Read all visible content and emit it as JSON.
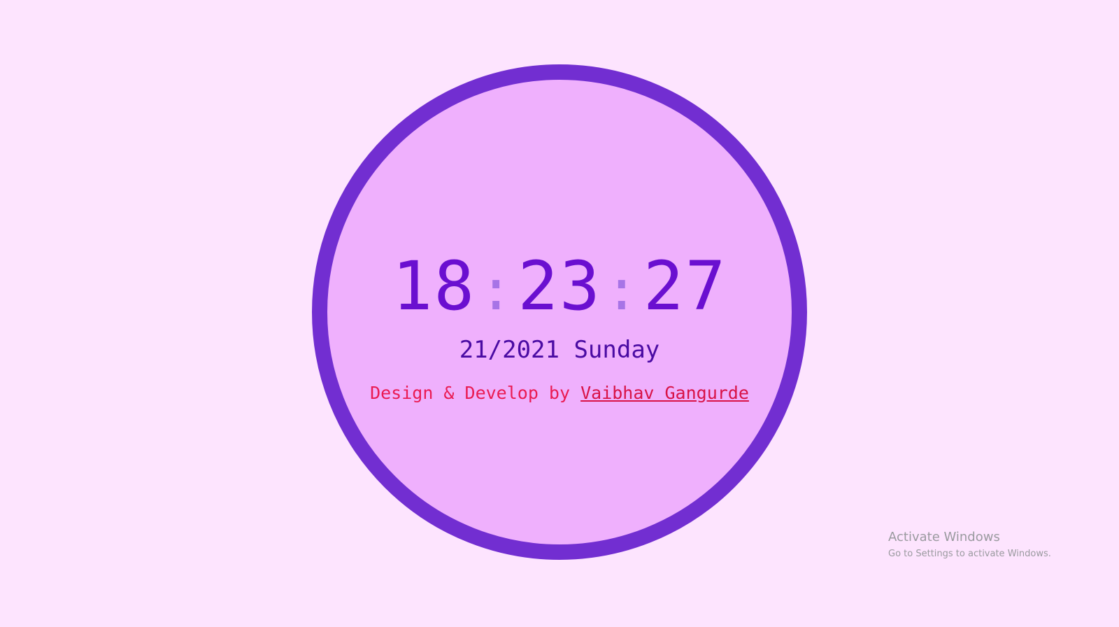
{
  "clock": {
    "hours": "18",
    "minutes": "23",
    "seconds": "27",
    "separator": ":",
    "date": "21/2021 Sunday"
  },
  "credit": {
    "prefix": "Design & Develop by ",
    "author": "Vaibhav Gangurde"
  },
  "watermark": {
    "title": "Activate Windows",
    "subtitle": "Go to Settings to activate Windows."
  },
  "colors": {
    "background": "#fde4fe",
    "face": "#efb0fd",
    "ring": "#722ed1",
    "time": "#6a0fd0",
    "separator": "#a774e6",
    "date": "#4a0ba3",
    "credit": "#ea1a52"
  }
}
